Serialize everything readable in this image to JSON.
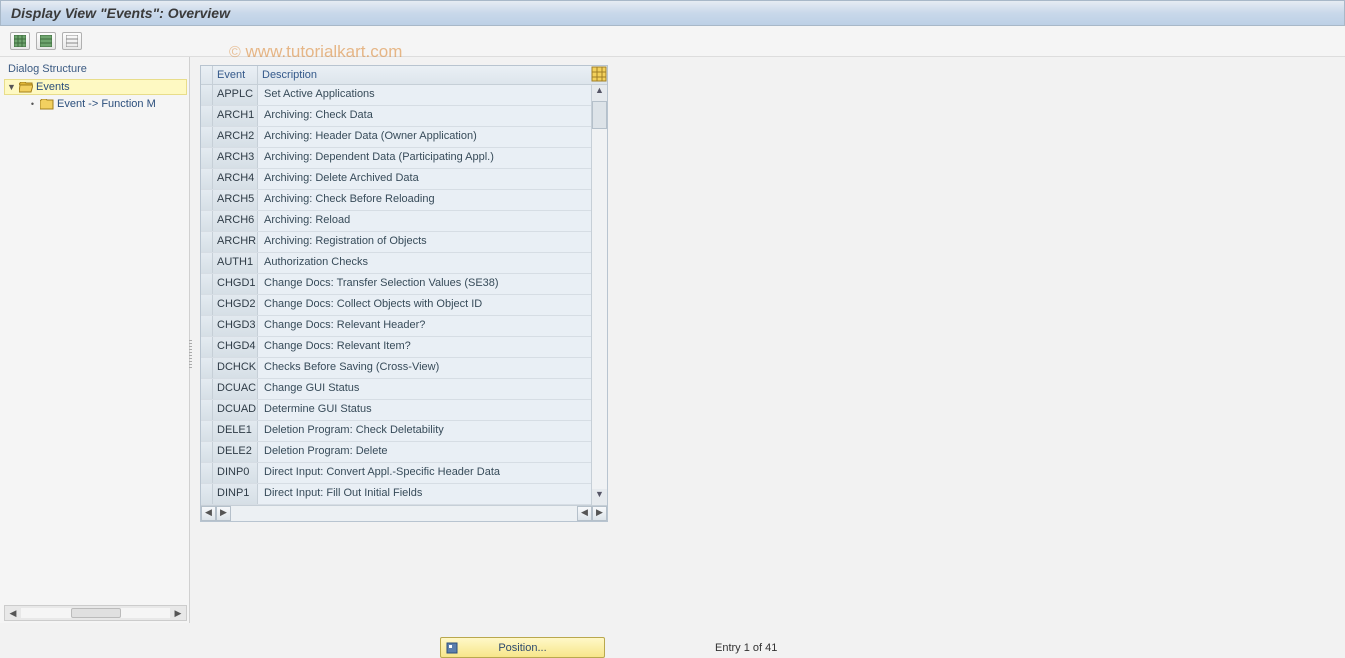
{
  "title": "Display View \"Events\": Overview",
  "watermark": "© www.tutorialkart.com",
  "toolbar": {
    "buttons": [
      "table-action-1",
      "table-action-2",
      "table-action-3"
    ]
  },
  "sidebar": {
    "header": "Dialog Structure",
    "root": {
      "label": "Events",
      "expanded": true
    },
    "child": {
      "label": "Event -> Function M"
    }
  },
  "table": {
    "columns": {
      "event": "Event",
      "description": "Description"
    },
    "rows": [
      {
        "event": "APPLC",
        "description": "Set Active Applications"
      },
      {
        "event": "ARCH1",
        "description": "Archiving: Check Data"
      },
      {
        "event": "ARCH2",
        "description": "Archiving: Header Data (Owner Application)"
      },
      {
        "event": "ARCH3",
        "description": "Archiving: Dependent Data (Participating Appl.)"
      },
      {
        "event": "ARCH4",
        "description": "Archiving: Delete Archived Data"
      },
      {
        "event": "ARCH5",
        "description": "Archiving: Check Before Reloading"
      },
      {
        "event": "ARCH6",
        "description": "Archiving: Reload"
      },
      {
        "event": "ARCHR",
        "description": "Archiving: Registration of Objects"
      },
      {
        "event": "AUTH1",
        "description": "Authorization Checks"
      },
      {
        "event": "CHGD1",
        "description": "Change Docs: Transfer Selection Values (SE38)"
      },
      {
        "event": "CHGD2",
        "description": "Change Docs: Collect Objects with Object ID"
      },
      {
        "event": "CHGD3",
        "description": "Change Docs: Relevant Header?"
      },
      {
        "event": "CHGD4",
        "description": "Change Docs: Relevant Item?"
      },
      {
        "event": "DCHCK",
        "description": "Checks Before Saving (Cross-View)"
      },
      {
        "event": "DCUAC",
        "description": "Change GUI Status"
      },
      {
        "event": "DCUAD",
        "description": "Determine GUI Status"
      },
      {
        "event": "DELE1",
        "description": "Deletion Program: Check Deletability"
      },
      {
        "event": "DELE2",
        "description": "Deletion Program: Delete"
      },
      {
        "event": "DINP0",
        "description": "Direct Input: Convert Appl.-Specific Header Data"
      },
      {
        "event": "DINP1",
        "description": "Direct Input: Fill Out Initial Fields"
      }
    ]
  },
  "footer": {
    "position_label": "Position...",
    "entry_status": "Entry 1 of 41"
  }
}
